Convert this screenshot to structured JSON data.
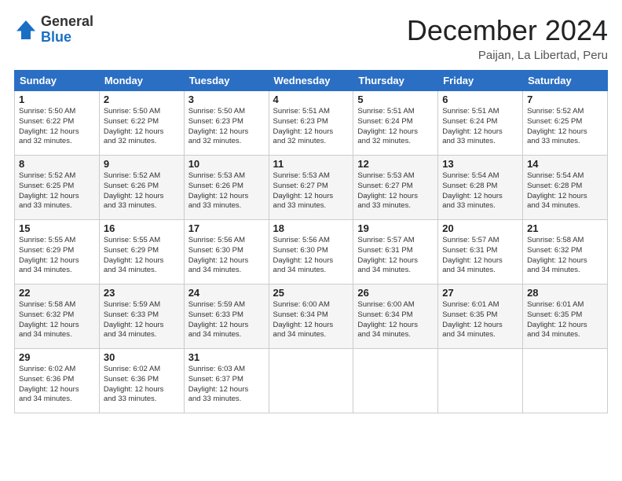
{
  "header": {
    "logo_general": "General",
    "logo_blue": "Blue",
    "title": "December 2024",
    "location": "Paijan, La Libertad, Peru"
  },
  "weekdays": [
    "Sunday",
    "Monday",
    "Tuesday",
    "Wednesday",
    "Thursday",
    "Friday",
    "Saturday"
  ],
  "weeks": [
    [
      {
        "day": "1",
        "info": "Sunrise: 5:50 AM\nSunset: 6:22 PM\nDaylight: 12 hours\nand 32 minutes."
      },
      {
        "day": "2",
        "info": "Sunrise: 5:50 AM\nSunset: 6:22 PM\nDaylight: 12 hours\nand 32 minutes."
      },
      {
        "day": "3",
        "info": "Sunrise: 5:50 AM\nSunset: 6:23 PM\nDaylight: 12 hours\nand 32 minutes."
      },
      {
        "day": "4",
        "info": "Sunrise: 5:51 AM\nSunset: 6:23 PM\nDaylight: 12 hours\nand 32 minutes."
      },
      {
        "day": "5",
        "info": "Sunrise: 5:51 AM\nSunset: 6:24 PM\nDaylight: 12 hours\nand 32 minutes."
      },
      {
        "day": "6",
        "info": "Sunrise: 5:51 AM\nSunset: 6:24 PM\nDaylight: 12 hours\nand 33 minutes."
      },
      {
        "day": "7",
        "info": "Sunrise: 5:52 AM\nSunset: 6:25 PM\nDaylight: 12 hours\nand 33 minutes."
      }
    ],
    [
      {
        "day": "8",
        "info": "Sunrise: 5:52 AM\nSunset: 6:25 PM\nDaylight: 12 hours\nand 33 minutes."
      },
      {
        "day": "9",
        "info": "Sunrise: 5:52 AM\nSunset: 6:26 PM\nDaylight: 12 hours\nand 33 minutes."
      },
      {
        "day": "10",
        "info": "Sunrise: 5:53 AM\nSunset: 6:26 PM\nDaylight: 12 hours\nand 33 minutes."
      },
      {
        "day": "11",
        "info": "Sunrise: 5:53 AM\nSunset: 6:27 PM\nDaylight: 12 hours\nand 33 minutes."
      },
      {
        "day": "12",
        "info": "Sunrise: 5:53 AM\nSunset: 6:27 PM\nDaylight: 12 hours\nand 33 minutes."
      },
      {
        "day": "13",
        "info": "Sunrise: 5:54 AM\nSunset: 6:28 PM\nDaylight: 12 hours\nand 33 minutes."
      },
      {
        "day": "14",
        "info": "Sunrise: 5:54 AM\nSunset: 6:28 PM\nDaylight: 12 hours\nand 34 minutes."
      }
    ],
    [
      {
        "day": "15",
        "info": "Sunrise: 5:55 AM\nSunset: 6:29 PM\nDaylight: 12 hours\nand 34 minutes."
      },
      {
        "day": "16",
        "info": "Sunrise: 5:55 AM\nSunset: 6:29 PM\nDaylight: 12 hours\nand 34 minutes."
      },
      {
        "day": "17",
        "info": "Sunrise: 5:56 AM\nSunset: 6:30 PM\nDaylight: 12 hours\nand 34 minutes."
      },
      {
        "day": "18",
        "info": "Sunrise: 5:56 AM\nSunset: 6:30 PM\nDaylight: 12 hours\nand 34 minutes."
      },
      {
        "day": "19",
        "info": "Sunrise: 5:57 AM\nSunset: 6:31 PM\nDaylight: 12 hours\nand 34 minutes."
      },
      {
        "day": "20",
        "info": "Sunrise: 5:57 AM\nSunset: 6:31 PM\nDaylight: 12 hours\nand 34 minutes."
      },
      {
        "day": "21",
        "info": "Sunrise: 5:58 AM\nSunset: 6:32 PM\nDaylight: 12 hours\nand 34 minutes."
      }
    ],
    [
      {
        "day": "22",
        "info": "Sunrise: 5:58 AM\nSunset: 6:32 PM\nDaylight: 12 hours\nand 34 minutes."
      },
      {
        "day": "23",
        "info": "Sunrise: 5:59 AM\nSunset: 6:33 PM\nDaylight: 12 hours\nand 34 minutes."
      },
      {
        "day": "24",
        "info": "Sunrise: 5:59 AM\nSunset: 6:33 PM\nDaylight: 12 hours\nand 34 minutes."
      },
      {
        "day": "25",
        "info": "Sunrise: 6:00 AM\nSunset: 6:34 PM\nDaylight: 12 hours\nand 34 minutes."
      },
      {
        "day": "26",
        "info": "Sunrise: 6:00 AM\nSunset: 6:34 PM\nDaylight: 12 hours\nand 34 minutes."
      },
      {
        "day": "27",
        "info": "Sunrise: 6:01 AM\nSunset: 6:35 PM\nDaylight: 12 hours\nand 34 minutes."
      },
      {
        "day": "28",
        "info": "Sunrise: 6:01 AM\nSunset: 6:35 PM\nDaylight: 12 hours\nand 34 minutes."
      }
    ],
    [
      {
        "day": "29",
        "info": "Sunrise: 6:02 AM\nSunset: 6:36 PM\nDaylight: 12 hours\nand 34 minutes."
      },
      {
        "day": "30",
        "info": "Sunrise: 6:02 AM\nSunset: 6:36 PM\nDaylight: 12 hours\nand 33 minutes."
      },
      {
        "day": "31",
        "info": "Sunrise: 6:03 AM\nSunset: 6:37 PM\nDaylight: 12 hours\nand 33 minutes."
      },
      null,
      null,
      null,
      null
    ]
  ]
}
